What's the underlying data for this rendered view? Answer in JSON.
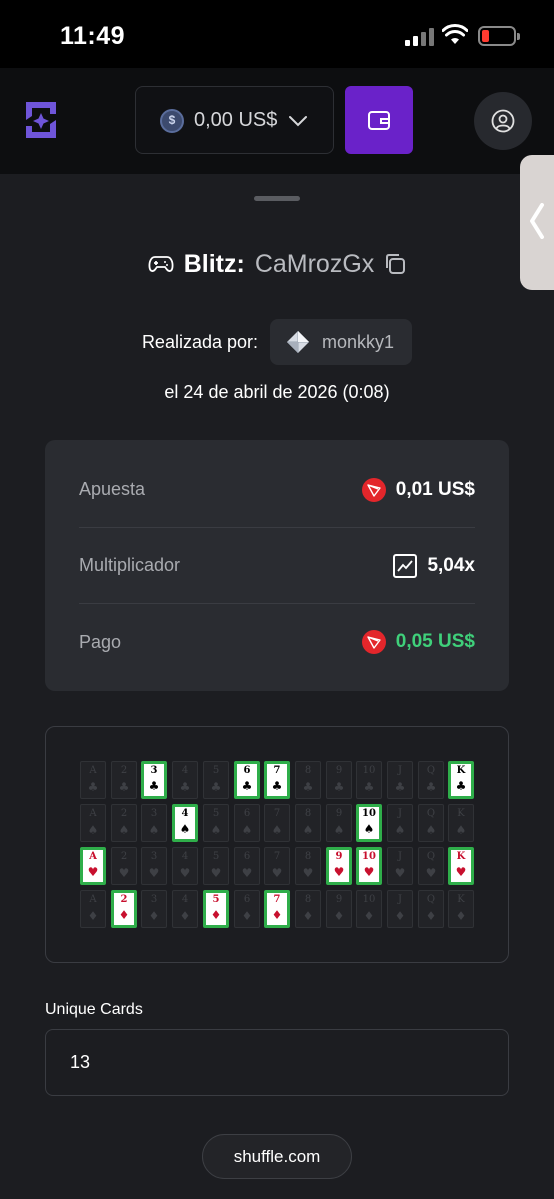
{
  "status_bar": {
    "time": "11:49"
  },
  "header": {
    "balance": "0,00 US$",
    "currency_icon": "usd-coin-icon",
    "wallet_icon": "wallet-icon",
    "profile_icon": "user-icon",
    "accent_color": "#6a22c9"
  },
  "bet": {
    "game": "Blitz:",
    "id": "CaMrozGx",
    "placed_by_label": "Realizada por:",
    "user": "monkky1",
    "date": "el 24 de abril de 2026 (0:08)",
    "details": [
      {
        "label": "Apuesta",
        "value": "0,01 US$",
        "icon": "tron-icon"
      },
      {
        "label": "Multiplicador",
        "value": "5,04x",
        "icon": "chart-icon"
      },
      {
        "label": "Pago",
        "value": "0,05 US$",
        "icon": "tron-icon",
        "color": "#3fd07a"
      }
    ]
  },
  "cards": {
    "ranks": [
      "A",
      "2",
      "3",
      "4",
      "5",
      "6",
      "7",
      "8",
      "9",
      "10",
      "J",
      "Q",
      "K"
    ],
    "suits": [
      {
        "name": "clubs",
        "symbol": "♣",
        "color": "black",
        "selected": [
          "3",
          "6",
          "7",
          "K"
        ]
      },
      {
        "name": "spades",
        "symbol": "♠",
        "color": "black",
        "selected": [
          "4",
          "10"
        ]
      },
      {
        "name": "hearts",
        "symbol": "♥",
        "color": "red",
        "selected": [
          "A",
          "9",
          "10",
          "K"
        ]
      },
      {
        "name": "diamonds",
        "symbol": "♦",
        "color": "red",
        "selected": [
          "2",
          "5",
          "7"
        ]
      }
    ],
    "highlight_color": "#2fae4a"
  },
  "unique_cards": {
    "label": "Unique Cards",
    "value": "13"
  },
  "footer": {
    "site": "shuffle.com"
  }
}
